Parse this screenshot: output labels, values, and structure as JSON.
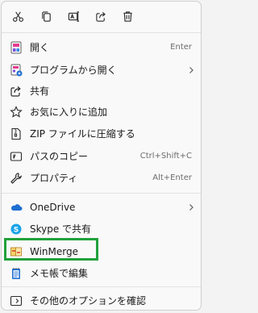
{
  "toolbar": {
    "buttons": [
      "cut-icon",
      "copy-icon",
      "rename-icon",
      "share-icon",
      "delete-icon"
    ]
  },
  "menu": {
    "items": [
      {
        "label": "開く",
        "shortcut": "Enter",
        "icon": "open-icon"
      },
      {
        "label": "プログラムから開く",
        "shortcut": "",
        "icon": "open-with-icon",
        "submenu": true
      },
      {
        "label": "共有",
        "shortcut": "",
        "icon": "share-icon"
      },
      {
        "label": "お気に入りに追加",
        "shortcut": "",
        "icon": "star-icon"
      },
      {
        "label": "ZIP ファイルに圧縮する",
        "shortcut": "",
        "icon": "zip-icon"
      },
      {
        "label": "パスのコピー",
        "shortcut": "Ctrl+Shift+C",
        "icon": "copy-path-icon"
      },
      {
        "label": "プロパティ",
        "shortcut": "Alt+Enter",
        "icon": "wrench-icon"
      },
      {
        "label": "OneDrive",
        "shortcut": "",
        "icon": "onedrive-icon",
        "submenu": true
      },
      {
        "label": "Skype で共有",
        "shortcut": "",
        "icon": "skype-icon"
      },
      {
        "label": "WinMerge",
        "shortcut": "",
        "icon": "winmerge-icon"
      },
      {
        "label": "メモ帳で編集",
        "shortcut": "",
        "icon": "notepad-icon"
      },
      {
        "label": "その他のオプションを確認",
        "shortcut": "",
        "icon": "more-options-icon"
      }
    ]
  },
  "colors": {
    "highlight": "#22a13b",
    "accent_blue": "#1f6fd1"
  }
}
